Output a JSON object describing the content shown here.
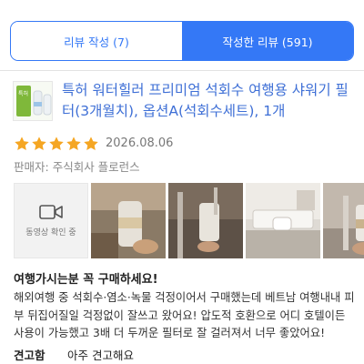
{
  "tabs": {
    "write_review": "리뷰 작성 (7)",
    "written_reviews": "작성한 리뷰 (591)"
  },
  "product": {
    "title": "특허 워터힐러 프리미엄 석회수 여행용 샤워기 필터(3개월치), 옵션A(석회수세트), 1개",
    "thumb_text": "특허"
  },
  "review": {
    "rating": 5,
    "max_rating": 5,
    "date": "2026.08.06",
    "seller_label": "판매자: ",
    "seller_name": "주식회사 플로런스",
    "video_label": "동영상 확인 중",
    "headline": "여행가시는분 꼭 구매하세요!",
    "body": "해외여행 중 석회수·염소·녹물 걱정이어서 구매했는데 베트남 여행내내 피부 뒤집어질일 걱정없이 잘쓰고 왔어요! 압도적 호환으로 어디 호텔이든 사용이 가능했고 3배 더 두꺼운 필터로 잘 걸러져서 너무 좋았어요!",
    "note_label": "견고함",
    "note_value": "아주 견고해요"
  },
  "colors": {
    "accent": "#3478f6",
    "star": "#f5a623",
    "title": "#3e6fd6"
  },
  "icons": {
    "video": "video-camera-icon",
    "star": "star-icon"
  }
}
